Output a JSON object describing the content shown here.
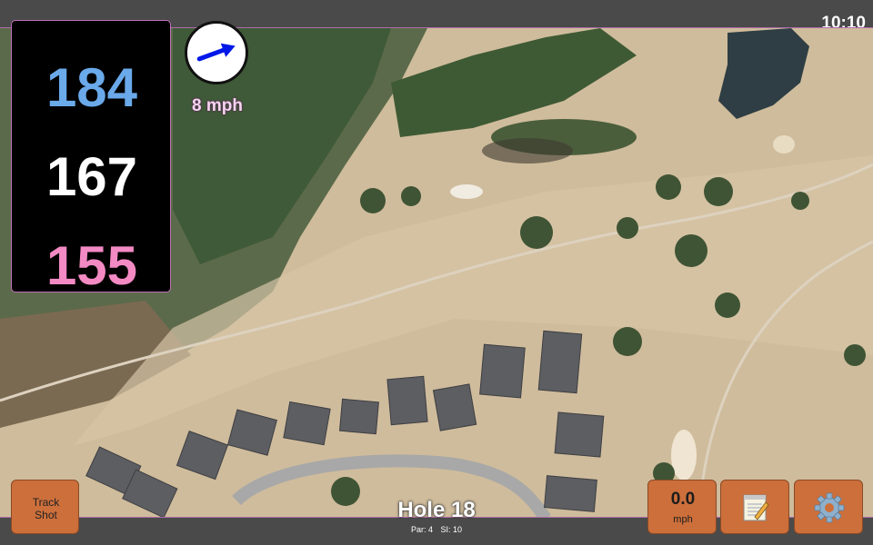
{
  "status_bar": {
    "time": "10:10"
  },
  "distances": {
    "back": "184",
    "middle": "167",
    "front": "155"
  },
  "wind": {
    "speed_label": "8 mph",
    "direction_degrees": 70,
    "arrow_color": "#0018e8"
  },
  "hole": {
    "title": "Hole 18",
    "par_label": "Par: 4",
    "si_label": "SI: 10"
  },
  "buttons": {
    "track_shot_line1": "Track",
    "track_shot_line2": "Shot",
    "speed_value": "0.0",
    "speed_unit": "mph",
    "notes_icon": "notepad-icon",
    "settings_icon": "gear-icon"
  },
  "colors": {
    "back": "#6aa9ea",
    "middle": "#ffffff",
    "front": "#f38ac4",
    "button": "#cc6f3b",
    "map_border": "#b06aa8"
  }
}
